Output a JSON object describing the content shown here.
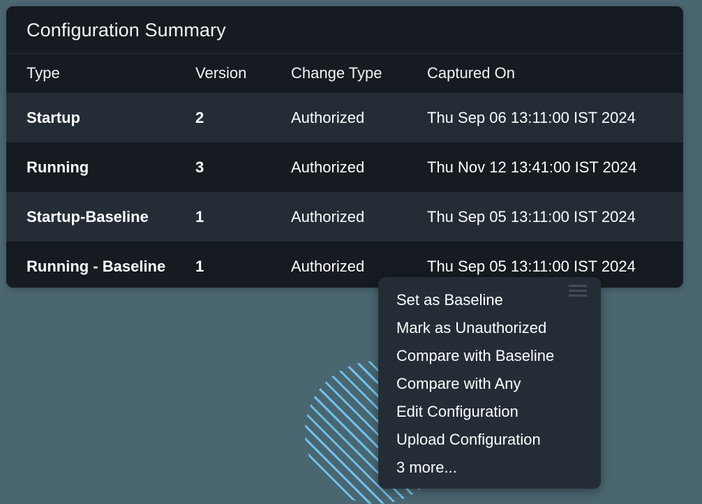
{
  "card": {
    "title": "Configuration Summary",
    "columns": [
      "Type",
      "Version",
      "Change Type",
      "Captured On"
    ],
    "rows": [
      {
        "type": "Startup",
        "version": "2",
        "change_type": "Authorized",
        "captured_on": "Thu Sep 06 13:11:00 IST 2024"
      },
      {
        "type": "Running",
        "version": "3",
        "change_type": "Authorized",
        "captured_on": "Thu Nov 12 13:41:00 IST 2024"
      },
      {
        "type": "Startup-Baseline",
        "version": "1",
        "change_type": "Authorized",
        "captured_on": "Thu Sep 05 13:11:00 IST 2024"
      },
      {
        "type": "Running - Baseline",
        "version": "1",
        "change_type": "Authorized",
        "captured_on": "Thu Sep 05 13:11:00 IST 2024"
      }
    ]
  },
  "context_menu": {
    "handle_icon": "hamburger-icon",
    "items": [
      {
        "label": "Set as Baseline"
      },
      {
        "label": "Mark as Unauthorized"
      },
      {
        "label": "Compare with Baseline"
      },
      {
        "label": "Compare with Any"
      },
      {
        "label": "Edit Configuration"
      },
      {
        "label": "Upload Configuration"
      },
      {
        "label": "3 more..."
      }
    ]
  },
  "decoration": {
    "stripe_color": "#6ec1ef",
    "background_color": "#4a6670"
  }
}
